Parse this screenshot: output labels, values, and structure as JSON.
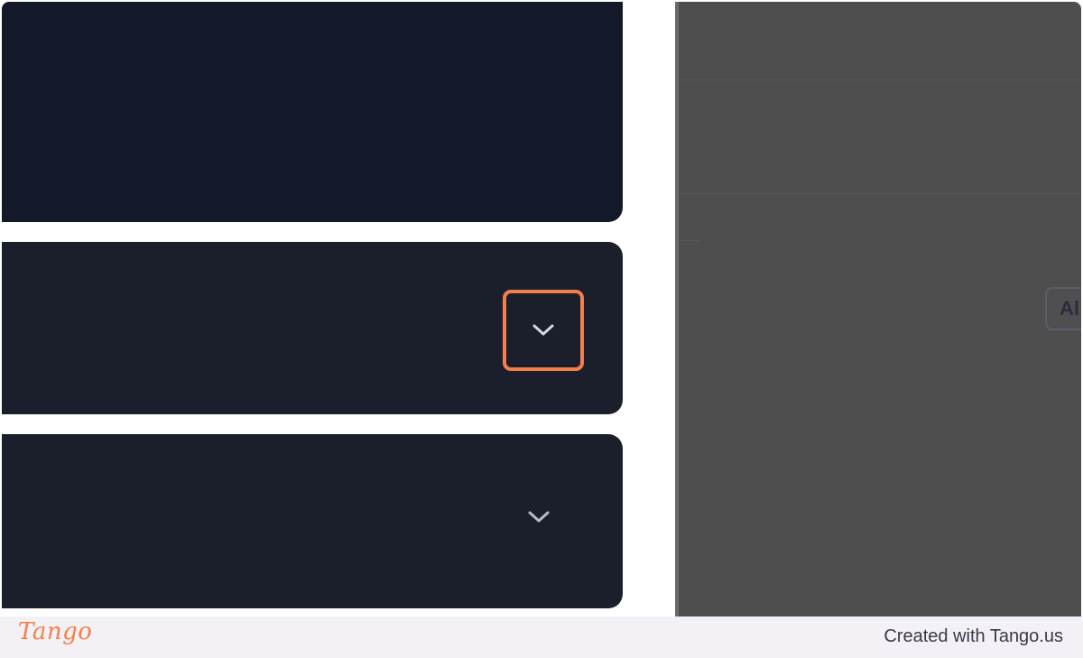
{
  "screen": {
    "cards": [
      {
        "id": "top"
      },
      {
        "id": "mid",
        "chevron_icon": "chevron-down-icon",
        "highlighted": true
      },
      {
        "id": "bottom",
        "chevron_icon": "chevron-down-icon",
        "highlighted": false
      }
    ],
    "right_pane": {
      "chip_label": "Al"
    }
  },
  "footer": {
    "logo_text": "Tango",
    "credit_text": "Created with Tango.us"
  },
  "colors": {
    "card_bg": "#1a1f2b",
    "highlight": "#f47f4a",
    "overlay": "#4e4e4e",
    "footer_bg": "#f3f1f6"
  }
}
